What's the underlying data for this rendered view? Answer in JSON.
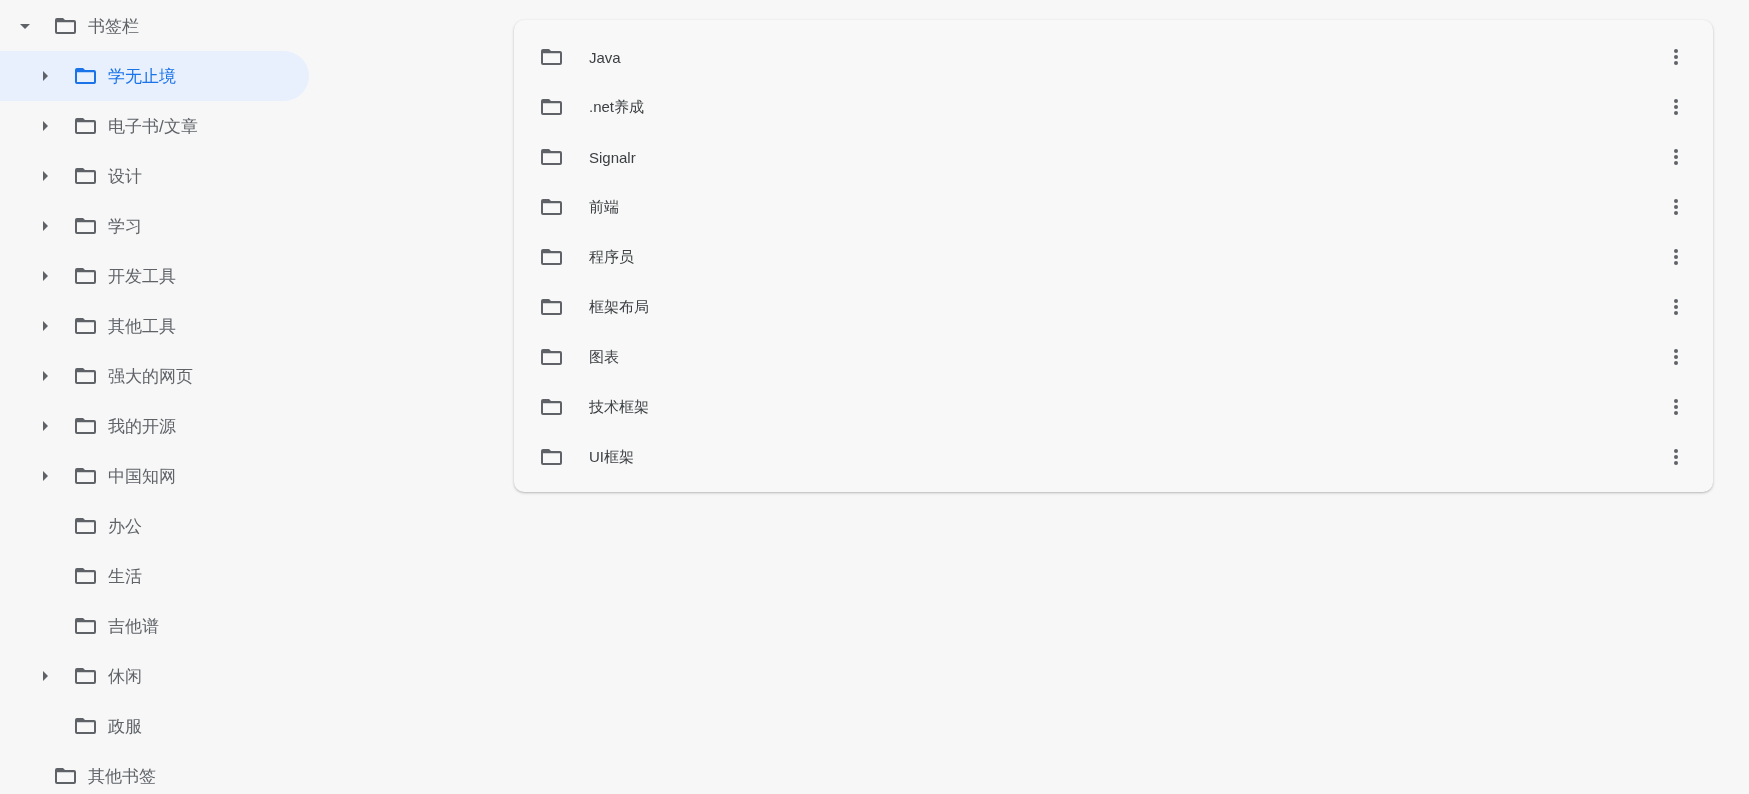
{
  "sidebar": {
    "tree": [
      {
        "label": "书签栏",
        "expanded": true,
        "selected": false,
        "children": [
          {
            "label": "学无止境",
            "expanded": false,
            "selected": true
          },
          {
            "label": "电子书/文章",
            "expanded": false,
            "selected": false
          },
          {
            "label": "设计",
            "expanded": false,
            "selected": false
          },
          {
            "label": "学习",
            "expanded": false,
            "selected": false
          },
          {
            "label": "开发工具",
            "expanded": false,
            "selected": false
          },
          {
            "label": "其他工具",
            "expanded": false,
            "selected": false
          },
          {
            "label": "强大的网页",
            "expanded": false,
            "selected": false
          },
          {
            "label": "我的开源",
            "expanded": false,
            "selected": false
          },
          {
            "label": "中国知网",
            "expanded": false,
            "selected": false
          },
          {
            "label": "办公",
            "selected": false
          },
          {
            "label": "生活",
            "selected": false
          },
          {
            "label": "吉他谱",
            "selected": false
          },
          {
            "label": "休闲",
            "expanded": false,
            "selected": false
          },
          {
            "label": "政服",
            "selected": false
          }
        ]
      },
      {
        "label": "其他书签",
        "selected": false
      }
    ]
  },
  "folder_list": {
    "items": [
      {
        "label": "Java"
      },
      {
        "label": ".net养成"
      },
      {
        "label": "Signalr"
      },
      {
        "label": "前端"
      },
      {
        "label": "程序员"
      },
      {
        "label": "框架布局"
      },
      {
        "label": "图表"
      },
      {
        "label": "技术框架"
      },
      {
        "label": "UI框架"
      }
    ]
  }
}
